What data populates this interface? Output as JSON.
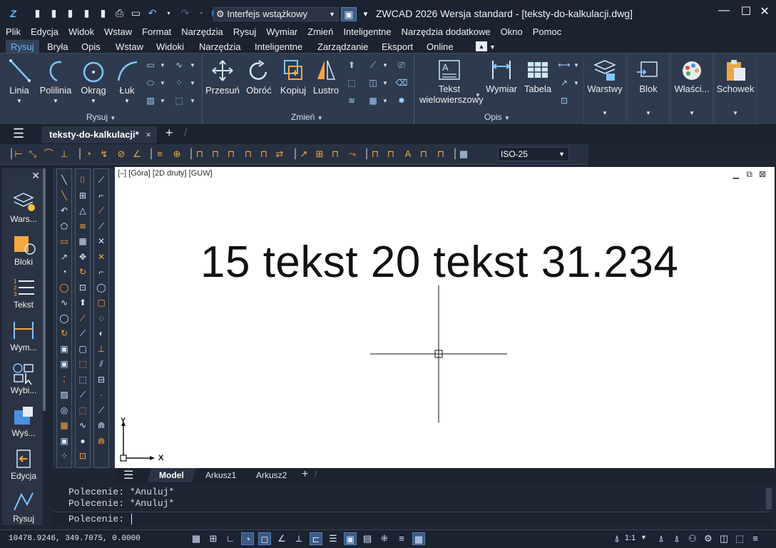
{
  "window": {
    "title": "ZWCAD 2026 Wersja standard - [teksty-do-kalkulacji.dwg]",
    "workspace": "Interfejs wstążkowy"
  },
  "menu": [
    "Plik",
    "Edycja",
    "Widok",
    "Wstaw",
    "Format",
    "Narzędzia",
    "Rysuj",
    "Wymiar",
    "Zmień",
    "Inteligentne",
    "Narzędzia dodatkowe",
    "Okno",
    "Pomoc"
  ],
  "ribbon_tabs": [
    "Rysuj",
    "Bryła",
    "Opis",
    "Wstaw",
    "Widoki",
    "Narzędzia",
    "Inteligentne",
    "Zarządzanie",
    "Eksport",
    "Online"
  ],
  "ribbon": {
    "draw": {
      "line": "Linia",
      "polyline": "Polilinia",
      "circle": "Okrąg",
      "arc": "Łuk",
      "panel": "Rysuj"
    },
    "modify": {
      "move": "Przesuń",
      "rotate": "Obróć",
      "copy": "Kopiuj",
      "mirror": "Lustro",
      "panel": "Zmień"
    },
    "annot": {
      "mtext_line1": "Tekst",
      "mtext_line2": "wielowierszowy",
      "dimension": "Wymiar",
      "table": "Tabela",
      "panel": "Opis"
    },
    "layers": "Warstwy",
    "block": "Blok",
    "properties": "Właści...",
    "clipboard": "Schowek"
  },
  "doc_tab": {
    "name": "teksty-do-kalkulacji*",
    "close": "×",
    "new": "+"
  },
  "dimstyle": "ISO-25",
  "palette": [
    "Wars...",
    "Bloki",
    "Tekst",
    "Wym...",
    "Wybi...",
    "Wyś...",
    "Edycja",
    "Rysuj"
  ],
  "canvas": {
    "viewport_label": "[–] [Góra] [2D druty] [GUW]",
    "text": "15 tekst 20 tekst 31.234",
    "axis_x": "X",
    "axis_y": "Y"
  },
  "layout_tabs": [
    "Model",
    "Arkusz1",
    "Arkusz2"
  ],
  "command": {
    "history": [
      "Polecenie: *Anuluj*",
      "Polecenie: *Anuluj*"
    ],
    "prompt": "Polecenie:"
  },
  "status": {
    "coords": "10478.9246, 349.7075, 0.0000",
    "scale": "1:1"
  },
  "colors": {
    "accent": "#5fb3ff",
    "ribbon_bg": "#2e3a4d",
    "canvas_bg": "#ffffff",
    "orange_icons": "#f5a742"
  }
}
